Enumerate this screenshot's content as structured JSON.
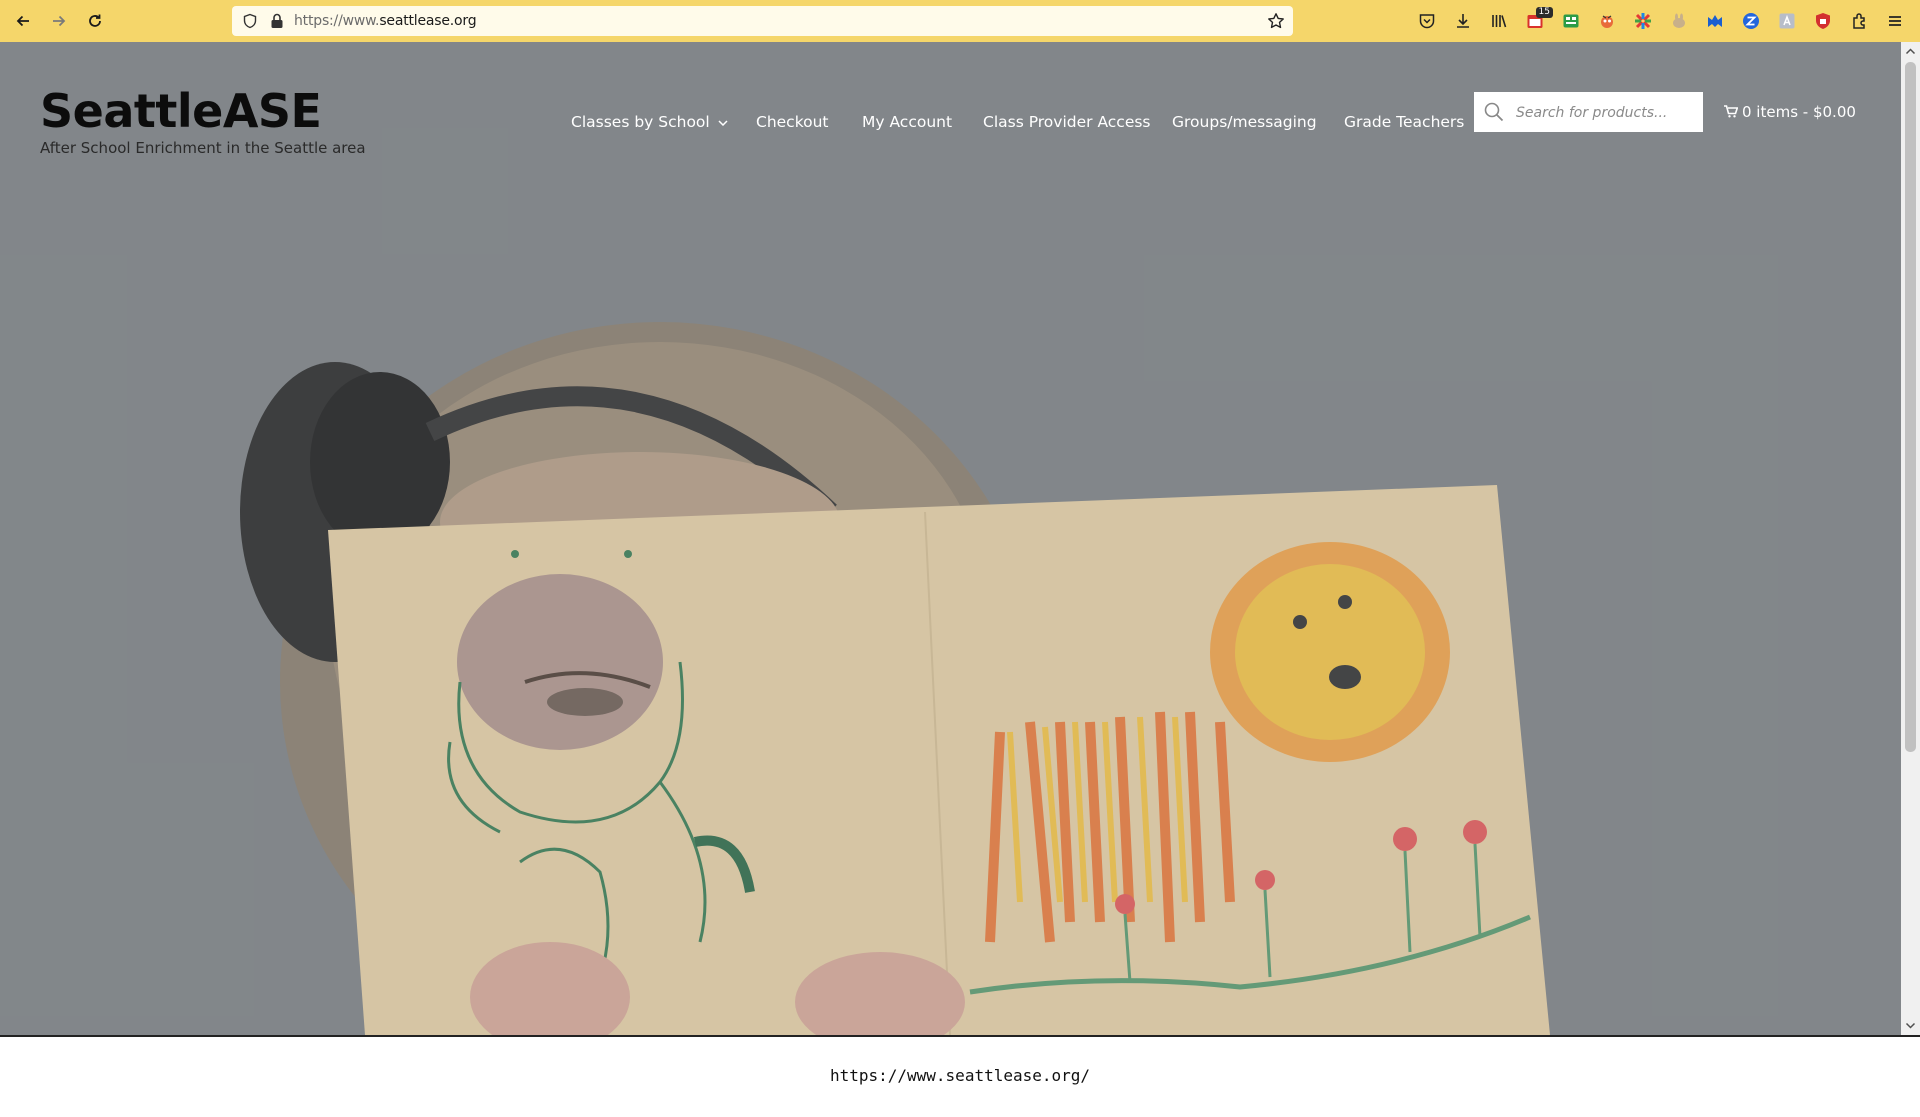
{
  "browser": {
    "url_prefix": "https://www.",
    "url_domain": "seattlease.org",
    "icons": [
      "back-icon",
      "forward-icon",
      "reload-icon",
      "shield-icon",
      "lock-icon",
      "bookmark-star-icon",
      "pocket-icon",
      "download-icon",
      "library-icon",
      "calendar-extension-icon",
      "tab-extension-icon",
      "extension-icon",
      "puzzle-multicolor-icon",
      "rabbit-extension-icon",
      "malwarebytes-icon",
      "zotero-icon",
      "translate-icon",
      "ublock-icon",
      "extensions-icon",
      "menu-icon"
    ],
    "calendar_badge": "15"
  },
  "site": {
    "title": "SeattleASE",
    "tagline": "After School Enrichment in the Seattle area"
  },
  "nav": {
    "items": [
      {
        "label": "Classes by School"
      },
      {
        "label": "Checkout"
      },
      {
        "label": "My Account"
      },
      {
        "label": "Class Provider Access"
      },
      {
        "label": "Groups/messaging"
      },
      {
        "label": "Grade Teachers"
      }
    ],
    "search_placeholder": "Search for products...",
    "cart_label": "0 items - $0.00"
  },
  "status": {
    "url": "https://www.seattlease.org/"
  }
}
